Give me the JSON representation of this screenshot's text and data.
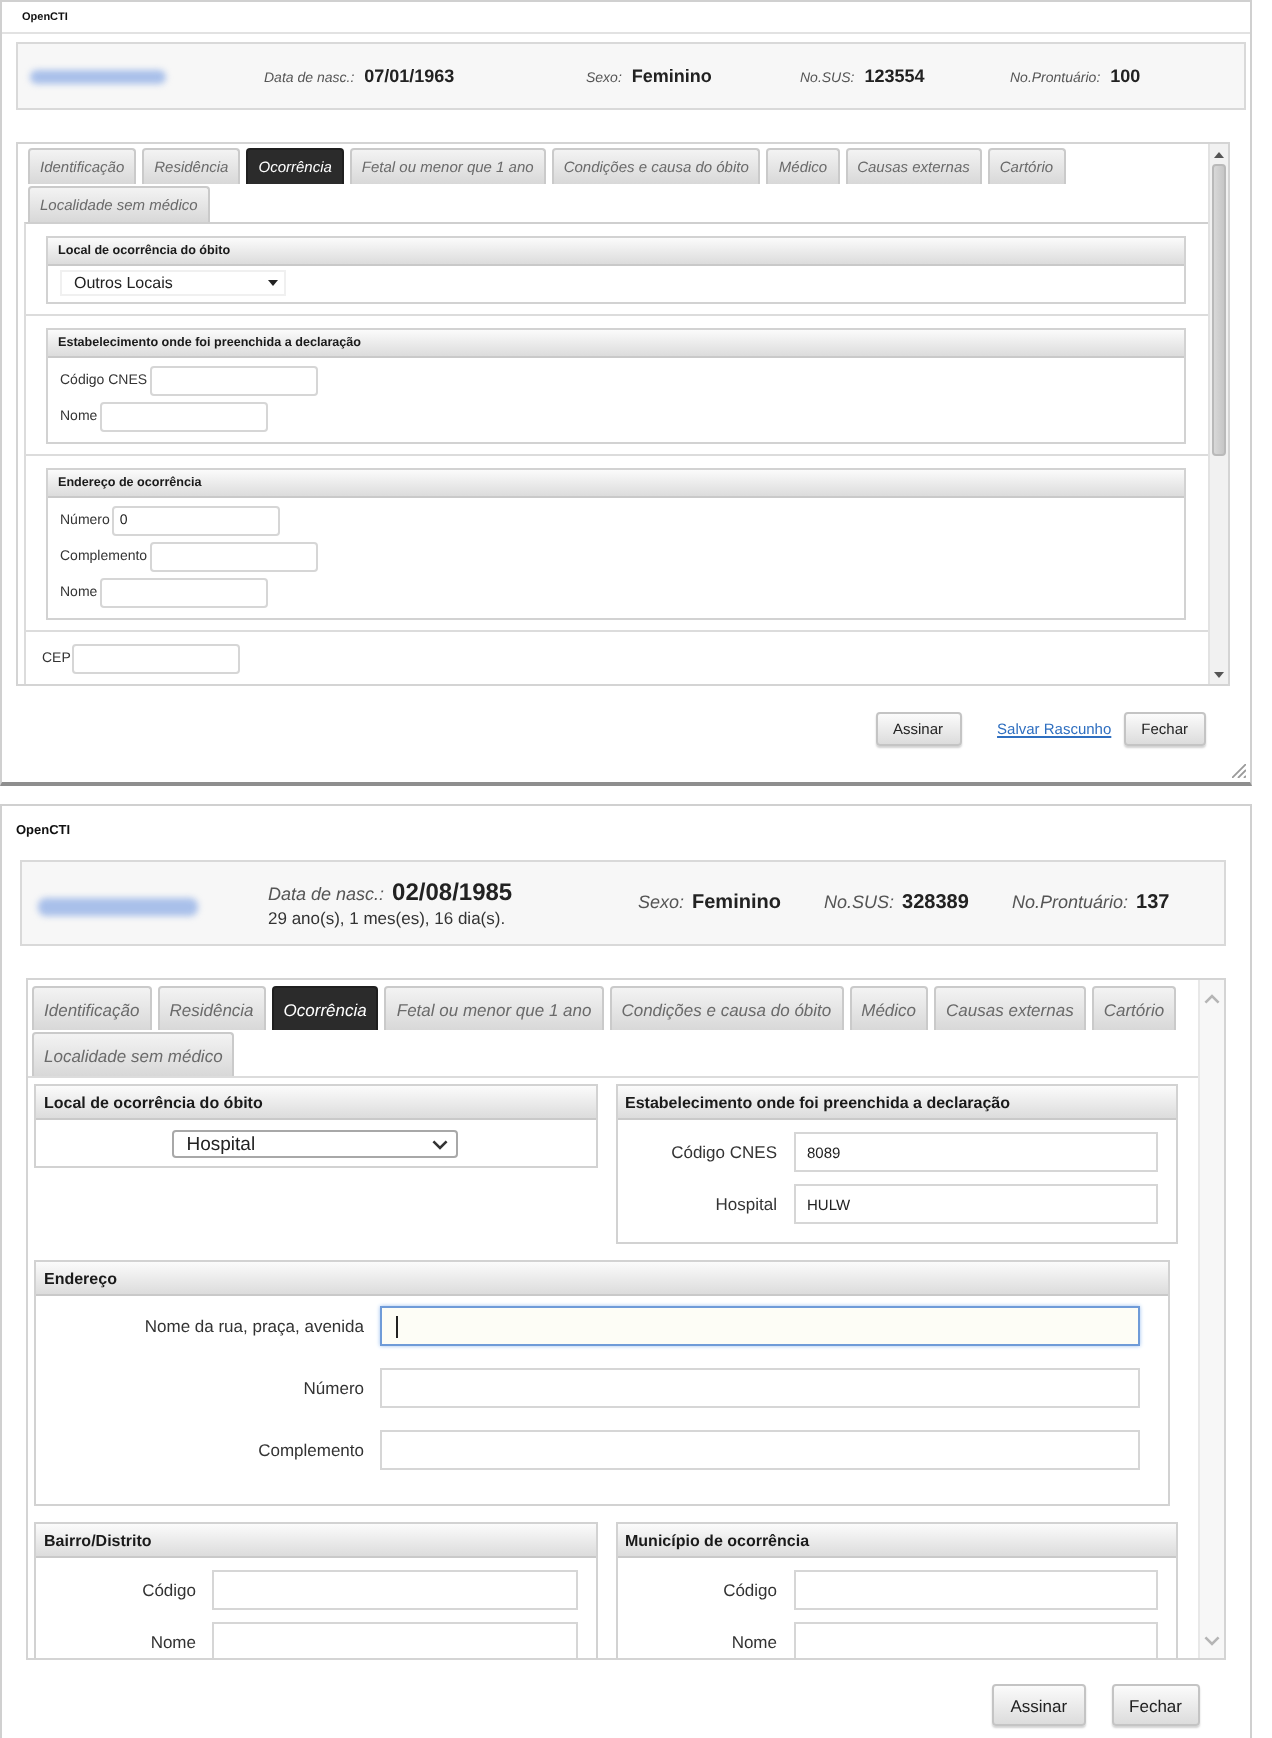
{
  "windows": [
    {
      "kind": "compact",
      "title": "OpenCTI",
      "patient": [
        {
          "label": "Data de nasc.:",
          "value": "07/01/1963"
        },
        {
          "label": "Sexo:",
          "value": "Feminino"
        },
        {
          "label": "No.SUS:",
          "value": "123554"
        },
        {
          "label": "No.Prontuário:",
          "value": "100"
        }
      ],
      "tabs": [
        {
          "label": "Identificação",
          "selected": false
        },
        {
          "label": "Residência",
          "selected": false
        },
        {
          "label": "Ocorrência",
          "selected": true
        },
        {
          "label": "Fetal ou menor que 1 ano",
          "selected": false
        },
        {
          "label": "Condições e causa do óbito",
          "selected": false
        },
        {
          "label": "Médico",
          "selected": false
        },
        {
          "label": "Causas externas",
          "selected": false
        },
        {
          "label": "Cartório",
          "selected": false
        },
        {
          "label": "Localidade sem médico",
          "selected": false
        }
      ],
      "rows": [
        {
          "sections": [
            {
              "title": "Local de ocorrência do óbito",
              "fields": [
                {
                  "kind": "select",
                  "value": "Outros Locais"
                }
              ]
            }
          ]
        },
        {
          "sections": [
            {
              "title": "Estabelecimento onde foi preenchida a declaração",
              "fields": [
                {
                  "kind": "text",
                  "label": "Código CNES",
                  "focused": false
                },
                {
                  "kind": "text",
                  "label": "Nome",
                  "focused": false
                }
              ]
            }
          ]
        },
        {
          "sections": [
            {
              "title": "Endereço de ocorrência",
              "fields": [
                {
                  "kind": "text",
                  "label": "Número",
                  "value": "0",
                  "focused": false
                },
                {
                  "kind": "text",
                  "label": "Complemento",
                  "focused": false
                },
                {
                  "kind": "text",
                  "label": "Nome",
                  "focused": false
                }
              ]
            }
          ]
        },
        {
          "sections": [
            {
              "fields": [
                {
                  "kind": "text",
                  "label": "CEP",
                  "focused": false
                }
              ]
            }
          ]
        }
      ],
      "buttons": [
        {
          "kind": "button",
          "label": "Assinar"
        },
        {
          "kind": "link",
          "label": "Salvar Rascunho"
        },
        {
          "kind": "button",
          "label": "Fechar"
        }
      ]
    },
    {
      "kind": "spacious",
      "title": "OpenCTI",
      "patient": [
        {
          "label": "Data de nasc.:",
          "value": "02/08/1985",
          "note": "29 ano(s), 1 mes(es), 16 dia(s)."
        },
        {
          "label": "Sexo:",
          "value": "Feminino"
        },
        {
          "label": "No.SUS:",
          "value": "328389"
        },
        {
          "label": "No.Prontuário:",
          "value": "137"
        }
      ],
      "tabs": [
        {
          "label": "Identificação",
          "selected": false
        },
        {
          "label": "Residência",
          "selected": false
        },
        {
          "label": "Ocorrência",
          "selected": true
        },
        {
          "label": "Fetal ou menor que 1 ano",
          "selected": false
        },
        {
          "label": "Condições e causa do óbito",
          "selected": false
        },
        {
          "label": "Médico",
          "selected": false
        },
        {
          "label": "Causas externas",
          "selected": false
        },
        {
          "label": "Cartório",
          "selected": false
        },
        {
          "label": "Localidade sem médico",
          "selected": false
        }
      ],
      "rows": [
        {
          "sections": [
            {
              "title": "Local de ocorrência do óbito",
              "fields": [
                {
                  "kind": "select",
                  "value": "Hospital"
                }
              ]
            },
            {
              "title": "Estabelecimento onde foi preenchida a declaração",
              "fields": [
                {
                  "kind": "text",
                  "label": "Código CNES",
                  "value": "8089",
                  "focused": false
                },
                {
                  "kind": "text",
                  "label": "Hospital",
                  "value": "HULW",
                  "focused": false
                }
              ]
            }
          ]
        },
        {
          "sections": [
            {
              "title": "Endereço",
              "fields": [
                {
                  "kind": "text",
                  "label": "Nome da rua, praça, avenida",
                  "focused": true
                },
                {
                  "kind": "text",
                  "label": "Número",
                  "focused": false
                },
                {
                  "kind": "text",
                  "label": "Complemento",
                  "focused": false
                }
              ]
            }
          ]
        },
        {
          "sections": [
            {
              "title": "Bairro/Distrito",
              "fields": [
                {
                  "kind": "text",
                  "label": "Código",
                  "focused": false
                },
                {
                  "kind": "text",
                  "label": "Nome",
                  "focused": false
                }
              ]
            },
            {
              "title": "Município de ocorrência",
              "fields": [
                {
                  "kind": "text",
                  "label": "Código",
                  "focused": false
                },
                {
                  "kind": "text",
                  "label": "Nome",
                  "focused": false
                }
              ]
            }
          ]
        }
      ],
      "buttons": [
        {
          "kind": "button",
          "label": "Assinar"
        },
        {
          "kind": "button",
          "label": "Fechar"
        }
      ]
    }
  ]
}
